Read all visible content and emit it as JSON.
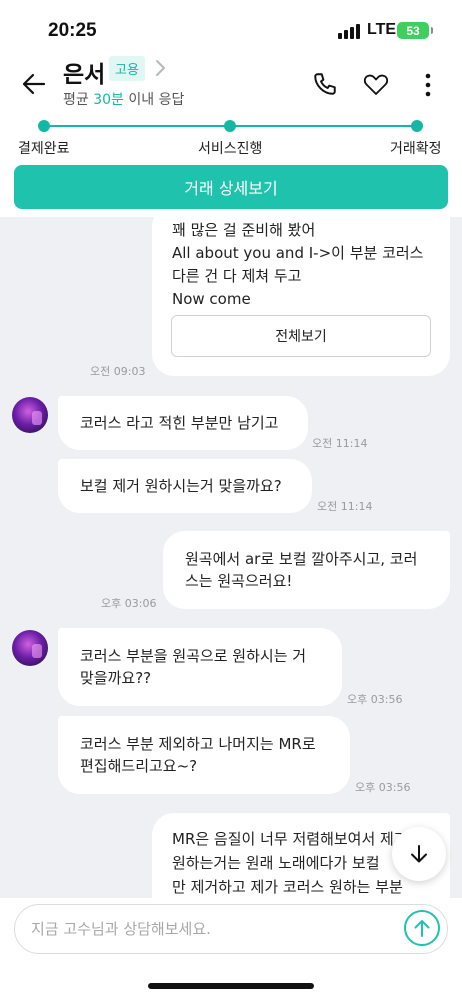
{
  "status_bar": {
    "time": "20:25",
    "network": "LTE",
    "battery": "53"
  },
  "header": {
    "title": "은서",
    "badge": "고용",
    "subtitle_prefix": "평균 ",
    "subtitle_highlight": "30분",
    "subtitle_suffix": " 이내 응답",
    "icons": [
      "back-arrow-icon",
      "chevron-right-icon",
      "phone-icon",
      "heart-icon",
      "more-vertical-icon"
    ]
  },
  "progress": {
    "steps": [
      "결제완료",
      "서비스진행",
      "거래확정"
    ]
  },
  "detail_button_label": "거래 상세보기",
  "messages": {
    "card": {
      "text": "꽤 많은 걸 준비해 봤어\nAll about you and I->이 부분 코러스\n다른 건 다 제쳐 두고\nNow come",
      "button": "전체보기",
      "time": "오전 09:03"
    },
    "m1": {
      "text": "코러스 라고 적힌 부분만 남기고",
      "time": "오전 11:14"
    },
    "m2": {
      "text": "보컬 제거 원하시는거 맞을까요?",
      "time": "오전 11:14"
    },
    "m3": {
      "text": "원곡에서 ar로 보컬 깔아주시고, 코러\n스는 원곡으러요!",
      "time": "오후 03:06"
    },
    "m4": {
      "text": "코러스 부분을 원곡으로 원하시는 거\n맞을까요??",
      "time": "오후 03:56"
    },
    "m5": {
      "text": "코러스 부분 제외하고 나머지는 MR로\n편집해드리고요~?",
      "time": "오후 03:56"
    },
    "m6": {
      "text": "MR은 음질이 너무 저렴해보여서 제가\n원하는거는 원래 노래에다가 보컬\n만 제거하고 제가 코러스 원하는 부분"
    }
  },
  "input": {
    "placeholder": "지금 고수님과 상담해보세요."
  },
  "colors": {
    "accent": "#1fc2ad",
    "chat_bg": "#eff0f3"
  }
}
